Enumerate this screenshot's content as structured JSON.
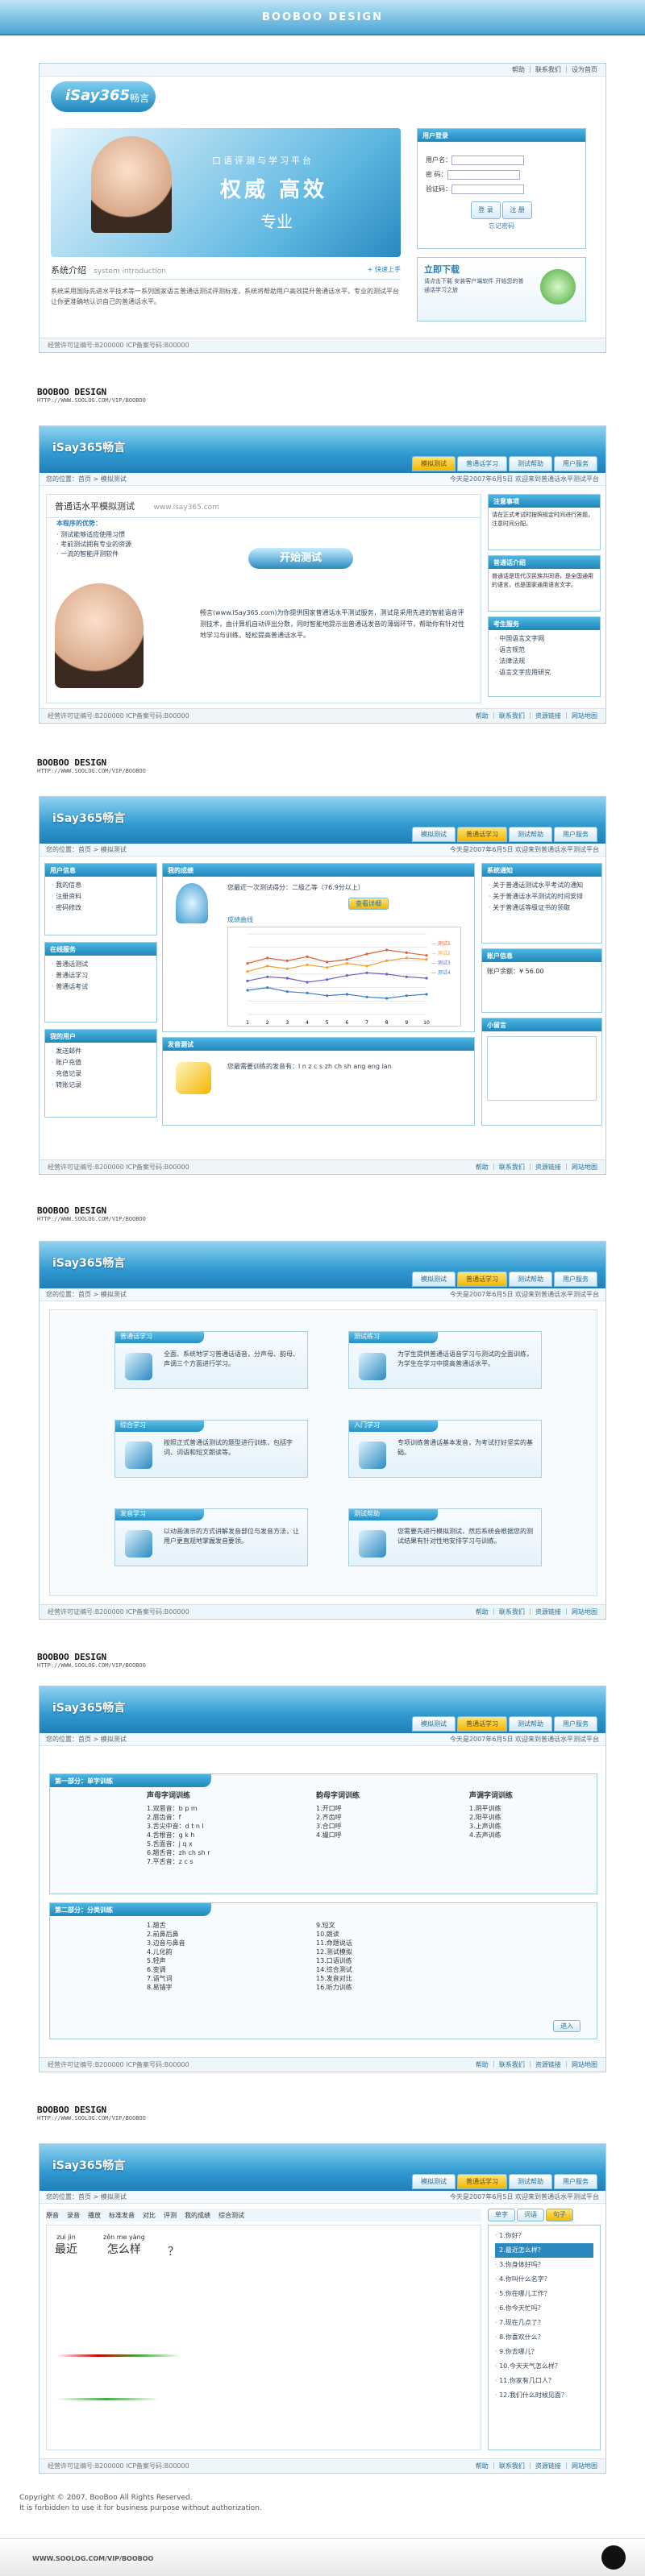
{
  "design_banner": "BOOBOO DESIGN",
  "brand_tag": {
    "name": "BOOBOO DESIGN",
    "url": "HTTP://WWW.SOOLOG.COM/VIP/BOOBOO"
  },
  "logo": "iSay365",
  "logo_cn": "畅言",
  "common_links": {
    "top": "帮助 ｜ 联系我们 ｜ 设为首页",
    "site": "网站首页",
    "footer": "帮助 ｜ 联系我们 ｜ 资源链接 ｜ 网站地图",
    "nav": [
      "模拟测试",
      "普通话学习",
      "测试帮助",
      "用户服务"
    ]
  },
  "crumb": "您的位置：首页 > 模拟测试",
  "crumb_right": "今天是2007年6月5日 欢迎来到普通话水平测试平台",
  "footer": {
    "copyright": "经营许可证编号:B200000 ICP备案号码:B00000"
  },
  "s1": {
    "slogan": "口语评测与学习平台",
    "headline": "权威 高效",
    "sub": "专业",
    "intro_title": "系统介绍",
    "intro_en": "system introduction",
    "more": "+ 快速上手",
    "intro_text": "系统采用国际先进水平技术等一系列国家语言普通话测试评测标准，系统将帮助用户高效提升普通话水平，专业的测试平台让你更准确地认识自己的普通话水平。",
    "login_title": "用户登录",
    "user_label": "用户名：",
    "pass_label": "密 码：",
    "code_label": "验证码：",
    "login_btn": "登 录",
    "register_btn": "注 册",
    "forget": "忘记密码",
    "download_title": "立即下载",
    "download_text": "请点击下载 安装客户端软件 开始您的普通话学习之旅"
  },
  "s2": {
    "test_title": "普通话水平模拟测试",
    "site": "www.isay365.com",
    "features_title": "本程序的优势：",
    "features": [
      "· 测试能够适应使用习惯",
      "· 考前测试拥有专业的资源",
      "· 一流的智能评测软件"
    ],
    "start": "开始测试",
    "desc": "畅言(www.iSay365.com)为你提供国家普通话水平测试服务，测试是采用先进的智能语音评测技术，由计算机自动评出分数，同时智能地提示出普通话发音的薄弱环节，帮助你有针对性地学习与训练，轻松提高普通话水平。",
    "notice_title": "注意事项",
    "notice": "请在正式考试时按照规定时间进行答题，注意时间分配。",
    "intro_title": "普通话介绍",
    "intro": "普通话是现代汉民族共同语，是全国通用的语言，也是国家通用语言文字。",
    "services_title": "考生服务",
    "services": [
      "中国语言文字网",
      "语言规范",
      "法律法规",
      "语言文字应用研究"
    ]
  },
  "s3": {
    "user_panel": "用户信息",
    "user_items": [
      "我的信息",
      "注册资料",
      "密码修改"
    ],
    "study_panel": "在线服务",
    "study_items": [
      "普通话测试",
      "普通话学习",
      "普通话考试"
    ],
    "my_panel": "我的用户",
    "my_items": [
      "发送邮件",
      "账户充值",
      "充值记录",
      "转账记录"
    ],
    "progress_title": "我的成绩",
    "progress_text": "您最近一次测试得分：二级乙等（76.9分以上）",
    "progress_link": "查看详细",
    "chart_title": "成绩曲线",
    "pron_title": "发音测试",
    "pron_text": "您最需要训练的发音有：l n z c s zh ch sh ang eng ian",
    "notice_title": "系统通知",
    "notices": [
      "关于普通话测试水平考试的通知",
      "关于普通话水平测试的时间安排",
      "关于普通话等级证书的领取"
    ],
    "account_title": "账户信息",
    "account_text": "账户余额：¥ 56.00",
    "msg_title": "小留言"
  },
  "chart_data": {
    "type": "line",
    "categories": [
      "1",
      "2",
      "3",
      "4",
      "5",
      "6",
      "7",
      "8",
      "9",
      "10"
    ],
    "series": [
      {
        "name": "测试1",
        "values": [
          68,
          72,
          70,
          73,
          69,
          71,
          75,
          78,
          76,
          74
        ]
      },
      {
        "name": "测试2",
        "values": [
          62,
          66,
          64,
          67,
          65,
          68,
          66,
          70,
          72,
          71
        ]
      },
      {
        "name": "测试3",
        "values": [
          55,
          58,
          57,
          54,
          56,
          59,
          61,
          60,
          58,
          57
        ]
      },
      {
        "name": "测试4",
        "values": [
          48,
          50,
          47,
          46,
          44,
          45,
          43,
          42,
          44,
          45
        ]
      }
    ],
    "ylim": [
      30,
      90
    ]
  },
  "s4": {
    "tiles": [
      {
        "title": "普通话学习",
        "text": "全面、系统地学习普通话语音，分声母、韵母、声调三个方面进行学习。"
      },
      {
        "title": "测试练习",
        "text": "为学生提供普通话语音学习与测试的全面训练，为学生在学习中提高普通话水平。"
      },
      {
        "title": "综合学习",
        "text": "按照正式普通话测试的题型进行训练，包括字词、词语和短文朗读等。"
      },
      {
        "title": "入门学习",
        "text": "专项训练普通话基本发音，为考试打好坚实的基础。"
      },
      {
        "title": "发音学习",
        "text": "以动画演示的方式讲解发音部位与发音方法，让用户更直观地掌握发音要领。"
      },
      {
        "title": "测试帮助",
        "text": "您需要先进行模拟测试，然后系统会根据您的测试结果有针对性地安排学习与训练。"
      }
    ]
  },
  "s5": {
    "bar1": "第一部分：单字训练",
    "col1_title": "声母字词训练",
    "col1": [
      "1.双唇音：b p m",
      "2.唇齿音：f",
      "3.舌尖中音：d t n l",
      "4.舌根音：g k h",
      "5.舌面音：j q x",
      "6.翘舌音：zh ch sh r",
      "7.平舌音：z c s"
    ],
    "col2_title": "韵母字词训练",
    "col2": [
      "1.开口呼",
      "2.齐齿呼",
      "3.合口呼",
      "4.撮口呼"
    ],
    "col3_title": "声调字词训练",
    "col3": [
      "1.阴平训练",
      "2.阳平训练",
      "3.上声训练",
      "4.去声训练"
    ],
    "bar2": "第二部分：分类训练",
    "col4": [
      "1.翘舌",
      "2.前鼻后鼻",
      "3.边音与鼻音",
      "4.儿化韵",
      "5.轻声",
      "6.变调",
      "7.语气词",
      "8.易错字"
    ],
    "col5": [
      "9.短文",
      "10.朗读",
      "11.命题说话",
      "12.测试模拟",
      "13.口语训练",
      "14.综合测试",
      "15.发音对比",
      "16.听力训练"
    ],
    "next": "进入"
  },
  "s6": {
    "toolbar": [
      "原音",
      "录音",
      "播放",
      "标准发音",
      "对比",
      "评测",
      "我的成绩",
      "综合测试"
    ],
    "side_tabs": [
      "单字",
      "词语",
      "句子"
    ],
    "pinyin1": "zuì jìn",
    "hanzi1": "最近",
    "pinyin2": "zěn me yàng",
    "hanzi2": "怎么样",
    "q": "？",
    "lessons": [
      "1.你好？",
      "2.最近怎么样？",
      "3.你身体好吗？",
      "4.你叫什么名字？",
      "5.你在哪儿工作？",
      "6.你今天忙吗？",
      "7.现在几点了？",
      "8.你喜欢什么？",
      "9.你去哪儿？",
      "10.今天天气怎么样？",
      "11.你家有几口人？",
      "12.我们什么时候见面？"
    ]
  },
  "copyright": {
    "line1": "Copyright © 2007, BooBoo All Rights Reserved.",
    "line2": "It is forbidden to use it for business purpose without authorization.",
    "url": "WWW.SOOLOG.COM/VIP/BOOBOO"
  },
  "colors": {
    "primary": "#2a8ac0",
    "accent": "#f2b600",
    "light": "#e3f2fa"
  }
}
